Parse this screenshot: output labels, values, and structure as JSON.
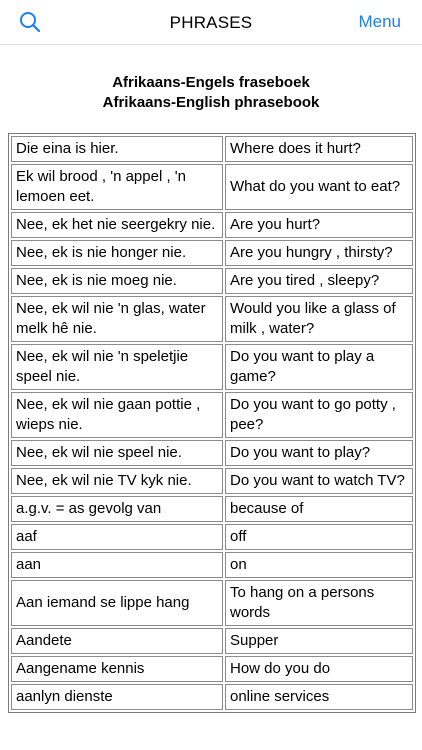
{
  "nav": {
    "title": "PHRASES",
    "menu_label": "Menu",
    "search_icon": "search-icon"
  },
  "heading": {
    "line1": "Afrikaans-Engels fraseboek",
    "line2": "Afrikaans-English phrasebook"
  },
  "rows": [
    {
      "af": "Die eina is hier.",
      "en": "Where does it hurt?"
    },
    {
      "af": "Ek wil brood , 'n appel , 'n lemoen eet.",
      "en": "What do you want to eat?"
    },
    {
      "af": "Nee, ek het nie seergekry nie.",
      "en": "Are you hurt?"
    },
    {
      "af": "Nee, ek is nie honger nie.",
      "en": "Are you hungry , thirsty?"
    },
    {
      "af": "Nee, ek is nie moeg nie.",
      "en": "Are you tired , sleepy?"
    },
    {
      "af": "Nee, ek wil nie 'n glas, water melk hê nie.",
      "en": "Would you like a glass of milk , water?"
    },
    {
      "af": "Nee, ek wil nie 'n speletjie speel nie.",
      "en": "Do you want to play a game?"
    },
    {
      "af": "Nee, ek wil nie gaan pottie , wieps nie.",
      "en": "Do you want to go potty , pee?"
    },
    {
      "af": "Nee, ek wil nie speel nie.",
      "en": "Do you want to play?"
    },
    {
      "af": "Nee, ek wil nie TV kyk nie.",
      "en": "Do you want to watch TV?"
    },
    {
      "af": "a.g.v. = as gevolg van",
      "en": "because of"
    },
    {
      "af": "aaf",
      "en": "off"
    },
    {
      "af": "aan",
      "en": "on"
    },
    {
      "af": "Aan iemand se lippe hang",
      "en": "To hang on a persons words"
    },
    {
      "af": "Aandete",
      "en": "Supper"
    },
    {
      "af": "Aangename kennis",
      "en": "How do you do"
    },
    {
      "af": "aanlyn dienste",
      "en": "online services"
    }
  ]
}
